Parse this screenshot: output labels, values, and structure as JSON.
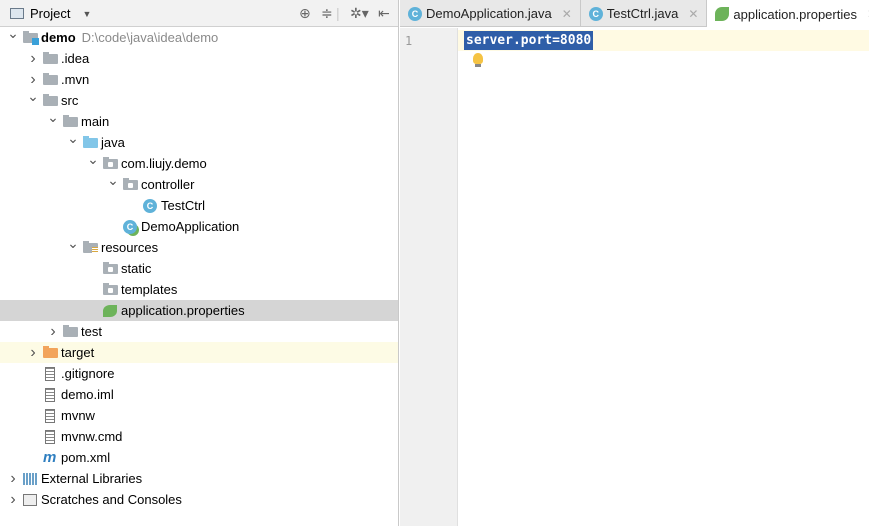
{
  "project_panel": {
    "title": "Project",
    "toolbar_icons": [
      "locate-icon",
      "collapse-all-icon",
      "gear-icon",
      "hide-icon"
    ]
  },
  "tree": [
    {
      "label": "demo",
      "path": "D:\\code\\java\\idea\\demo",
      "level": 0,
      "arrow": "down",
      "icon": "module-folder",
      "bold": true
    },
    {
      "label": ".idea",
      "level": 1,
      "arrow": "right",
      "icon": "folder"
    },
    {
      "label": ".mvn",
      "level": 1,
      "arrow": "right",
      "icon": "folder"
    },
    {
      "label": "src",
      "level": 1,
      "arrow": "down",
      "icon": "folder"
    },
    {
      "label": "main",
      "level": 2,
      "arrow": "down",
      "icon": "folder"
    },
    {
      "label": "java",
      "level": 3,
      "arrow": "down",
      "icon": "source-folder"
    },
    {
      "label": "com.liujy.demo",
      "level": 4,
      "arrow": "down",
      "icon": "package"
    },
    {
      "label": "controller",
      "level": 5,
      "arrow": "down",
      "icon": "package"
    },
    {
      "label": "TestCtrl",
      "level": 6,
      "arrow": "none",
      "icon": "class"
    },
    {
      "label": "DemoApplication",
      "level": 5,
      "arrow": "none",
      "icon": "spring-class"
    },
    {
      "label": "resources",
      "level": 3,
      "arrow": "down",
      "icon": "resources-folder"
    },
    {
      "label": "static",
      "level": 4,
      "arrow": "none",
      "icon": "package"
    },
    {
      "label": "templates",
      "level": 4,
      "arrow": "none",
      "icon": "package"
    },
    {
      "label": "application.properties",
      "level": 4,
      "arrow": "none",
      "icon": "spring-properties",
      "selected": true
    },
    {
      "label": "test",
      "level": 2,
      "arrow": "right",
      "icon": "folder"
    },
    {
      "label": "target",
      "level": 1,
      "arrow": "right",
      "icon": "excluded-folder",
      "highlight": true
    },
    {
      "label": ".gitignore",
      "level": 1,
      "arrow": "none",
      "icon": "file"
    },
    {
      "label": "demo.iml",
      "level": 1,
      "arrow": "none",
      "icon": "file"
    },
    {
      "label": "mvnw",
      "level": 1,
      "arrow": "none",
      "icon": "file"
    },
    {
      "label": "mvnw.cmd",
      "level": 1,
      "arrow": "none",
      "icon": "file"
    },
    {
      "label": "pom.xml",
      "level": 1,
      "arrow": "none",
      "icon": "maven"
    },
    {
      "label": "External Libraries",
      "level": 0,
      "arrow": "right",
      "icon": "libraries"
    },
    {
      "label": "Scratches and Consoles",
      "level": 0,
      "arrow": "right",
      "icon": "scratches"
    }
  ],
  "tabs": [
    {
      "label": "DemoApplication.java",
      "icon": "spring-class",
      "color": "#5fb2d9"
    },
    {
      "label": "TestCtrl.java",
      "icon": "class",
      "color": "#5fb2d9"
    },
    {
      "label": "application.properties",
      "icon": "spring-properties",
      "color": "#6db35a",
      "active": true
    }
  ],
  "editor": {
    "line_number": "1",
    "code": "server.port=8080"
  }
}
